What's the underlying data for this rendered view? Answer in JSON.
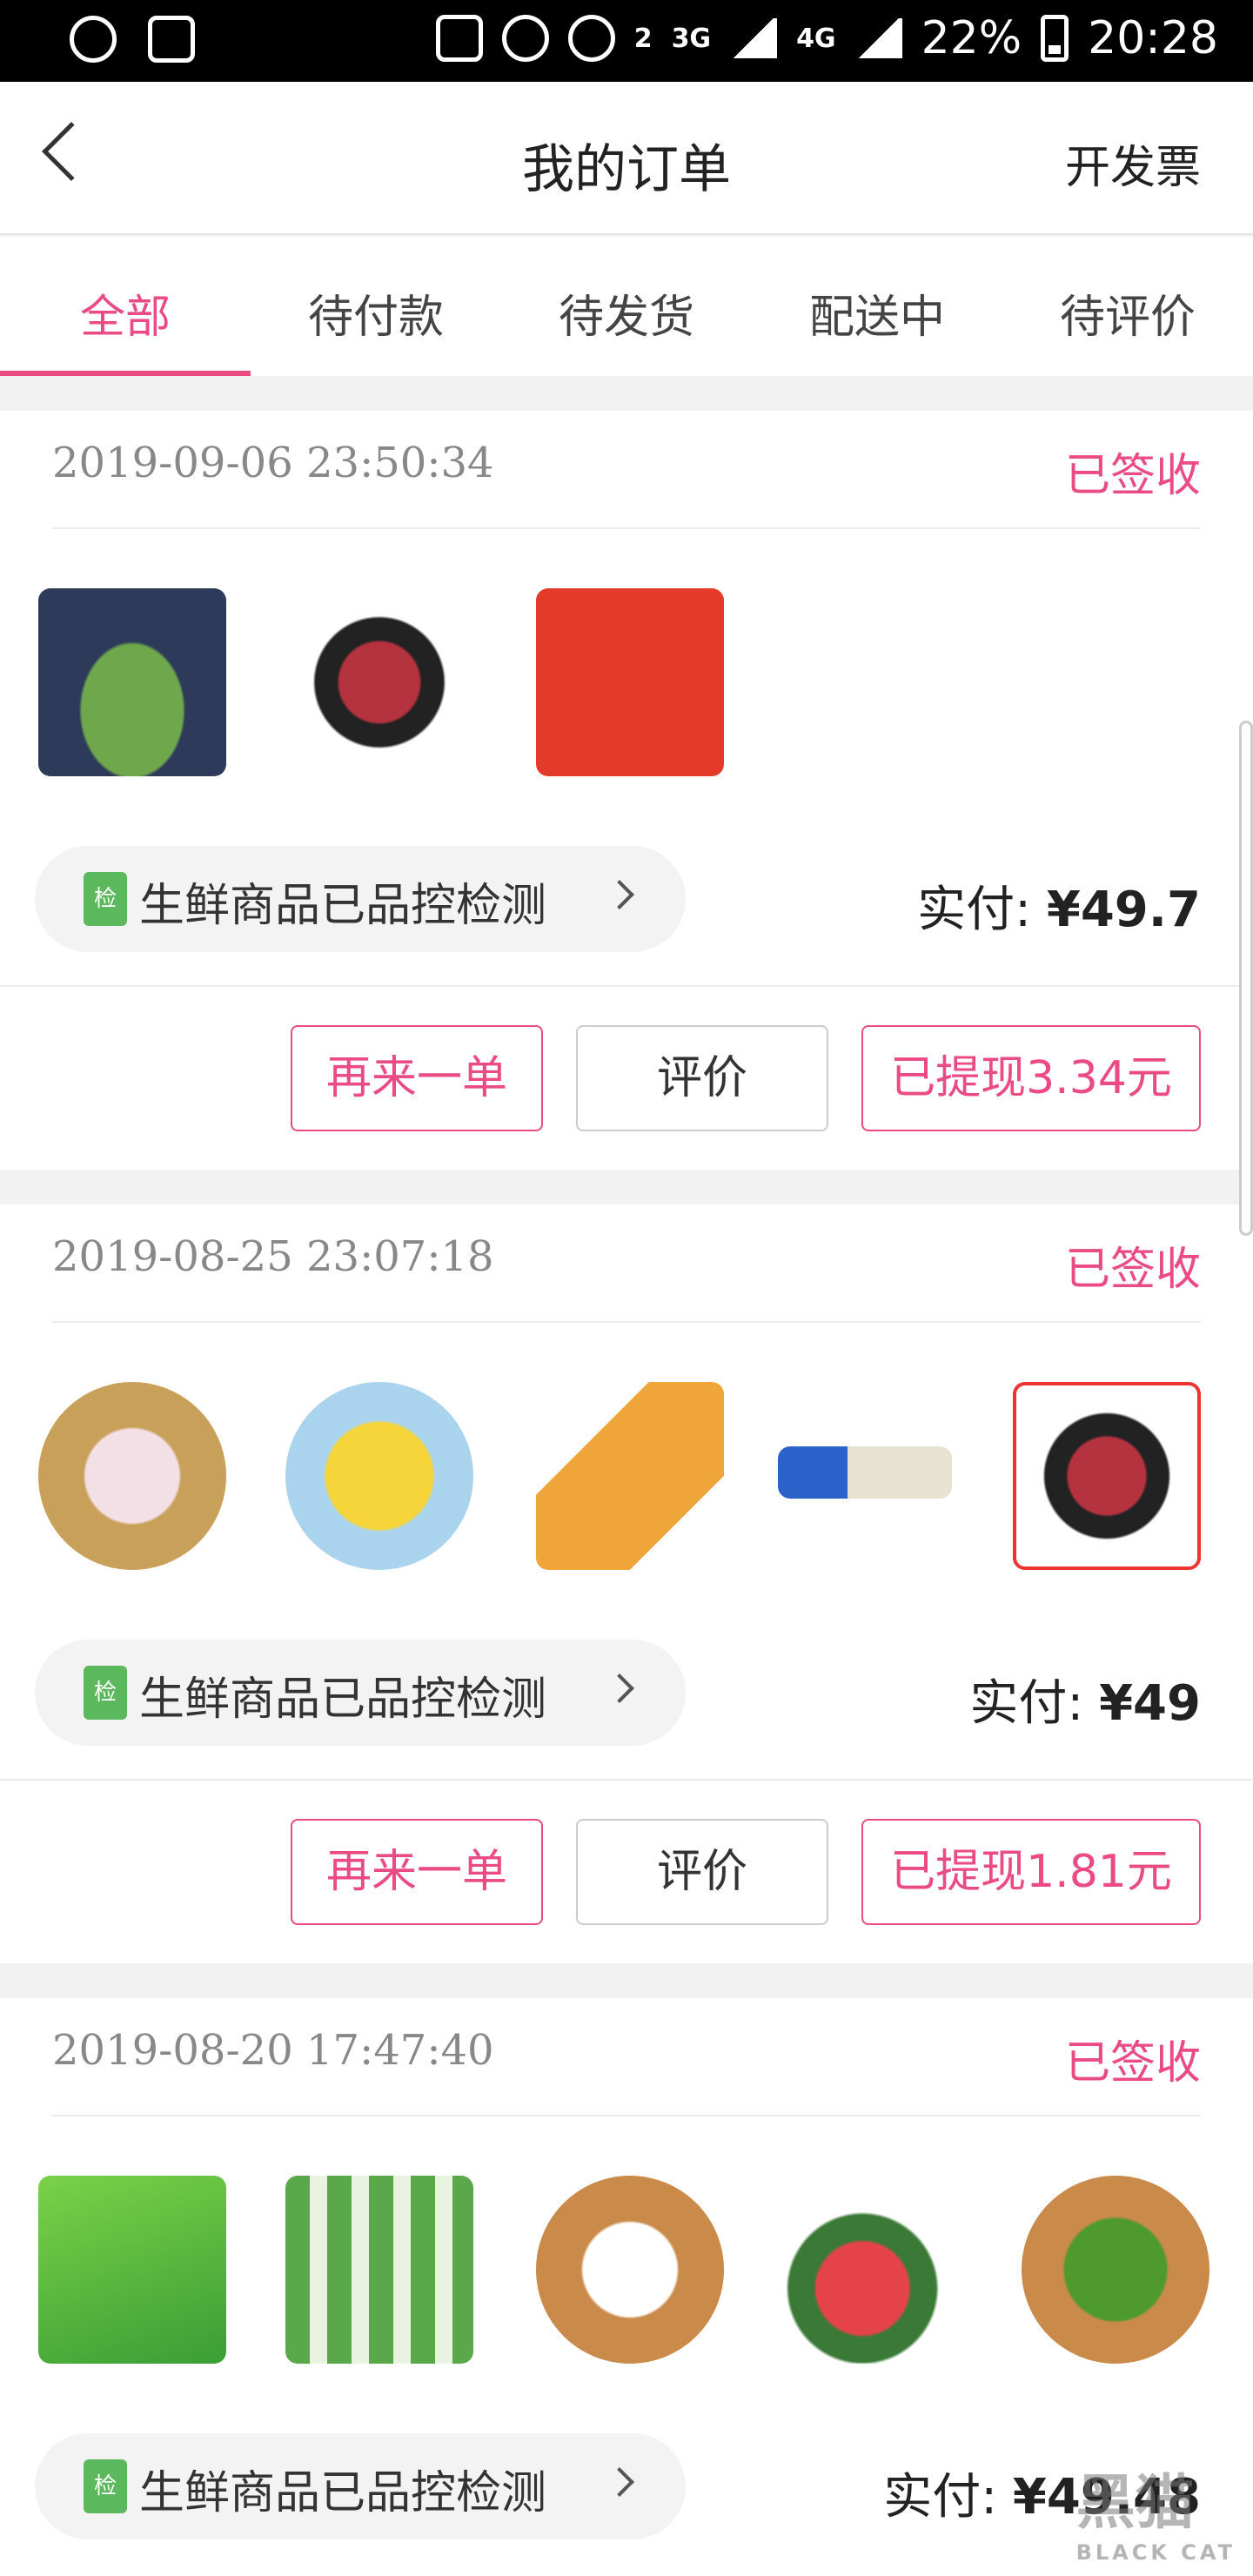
{
  "status_bar": {
    "network_3g": "3G",
    "network_4g": "4G",
    "sim_badge": "2",
    "battery": "22%",
    "time": "20:28"
  },
  "header": {
    "title": "我的订单",
    "invoice_label": "开发票"
  },
  "tabs": [
    "全部",
    "待付款",
    "待发货",
    "配送中",
    "待评价"
  ],
  "accent_color": "#e94b82",
  "orders": [
    {
      "date": "2019-09-06 23:50:34",
      "status": "已签收",
      "products": [
        "watermelon",
        "beef",
        "hot-and-sour-noodles"
      ],
      "qc_badge": "检",
      "qc_label": "生鲜商品已品控检测",
      "paid_label": "实付:",
      "paid_amount": "¥49.7",
      "btn_reorder": "再来一单",
      "btn_review": "评价",
      "btn_cashback": "已提现3.34元"
    },
    {
      "date": "2019-08-25 23:07:18",
      "status": "已签收",
      "products": [
        "onions",
        "bananas",
        "duck-snack",
        "biscuit-pack",
        "beef"
      ],
      "qc_badge": "检",
      "qc_label": "生鲜商品已品控检测",
      "paid_label": "实付:",
      "paid_amount": "¥49",
      "btn_reorder": "再来一单",
      "btn_review": "评价",
      "btn_cashback": "已提现1.81元"
    },
    {
      "date": "2019-08-20 17:47:40",
      "status": "已签收",
      "products": [
        "onion-rings-snack",
        "yogurt-bars",
        "tofu",
        "watermelon",
        "green-peppers"
      ],
      "qc_badge": "检",
      "qc_label": "生鲜商品已品控检测",
      "paid_label": "实付:",
      "paid_amount": "¥49.48"
    }
  ],
  "watermark": {
    "text": "黑猫",
    "sub": "BLACK CAT"
  }
}
